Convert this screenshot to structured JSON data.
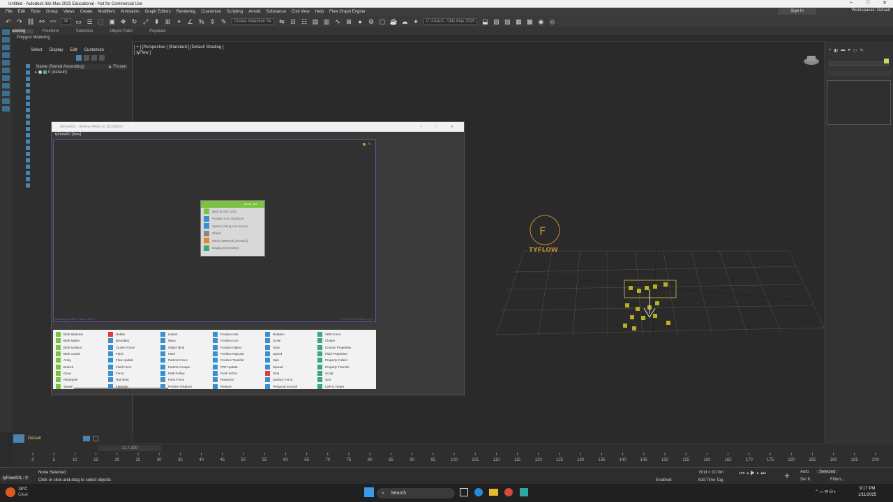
{
  "window": {
    "title": "Untitled - Autodesk 3ds Max 2025 Educational - Not for Commercial Use"
  },
  "menu": [
    "File",
    "Edit",
    "Tools",
    "Group",
    "Views",
    "Create",
    "Modifiers",
    "Animation",
    "Graph Editors",
    "Rendering",
    "Customize",
    "Scripting",
    "Arnold",
    "Substance",
    "Civil View",
    "Help",
    "Flow Graph Engine"
  ],
  "header": {
    "sign_in": "Sign In",
    "workspace": "Workspaces: Default"
  },
  "toolbar": {
    "filter": "All",
    "selection_set": "Create Selection Se",
    "path": "C:\\Users\\...\\3ds Max 2025"
  },
  "ribbon": {
    "tabs": [
      "Modeling",
      "Freeform",
      "Selection",
      "Object Paint",
      "Populate"
    ],
    "sub": "Polygon Modeling"
  },
  "scene_explorer": {
    "menu": [
      "Select",
      "Display",
      "Edit",
      "Customize"
    ],
    "column": "Name (Sorted Ascending)",
    "frozen": "▲ Frozen",
    "root": "0 (default)"
  },
  "viewport": {
    "label": "[ + ] [Perspective ] [Standard ] [Default Shading ]",
    "sublabel": "[ tyFlow ]",
    "logo_text": "TYFLOW"
  },
  "editor": {
    "title": "tyFlow001 - [tyFlow FREE v1.110 Editor]",
    "tab": "tyFlow001   [New]",
    "footer_left": "Caching enabled | Stats: 0/0/0/0",
    "footer_right": "Press TAB for Quick Type",
    "event": {
      "name": "Event_001",
      "operators": [
        "Birth (0-200: 200)",
        "Position Icon (Surface)",
        "Speed (Along icon arrow)",
        "Shape",
        "Mesh (NRMesh [Render])",
        "Display (Geometry)"
      ]
    },
    "palette": [
      [
        "Birth Skeleton",
        "Birth Spline",
        "Birth Surface",
        "Birth Voxels",
        "Array",
        "Branch",
        "Grow",
        "Resample",
        "Spawn"
      ],
      [
        "Delete",
        "Boundary",
        "Cluster Force",
        "Flock",
        "Flow Update",
        "Fluid Force",
        "Force",
        "Hair Bind",
        "Integrate"
      ],
      [
        "Limiter",
        "Mass",
        "Object Bind",
        "Pack",
        "Particle Force",
        "Particle Groups",
        "Path Follow",
        "Point Force",
        "Position Displace"
      ],
      [
        "Position Hair",
        "Position Icon",
        "Position Object",
        "Position Raycast",
        "Position Transfer",
        "PRT Update",
        "Push In/Out",
        "Rasterize",
        "Restore"
      ],
      [
        "Rotation",
        "Scale",
        "Slow",
        "Speed",
        "Spin",
        "Spread",
        "Stop",
        "Surface Force",
        "Temporal Smooth"
      ],
      [
        "VDB Force",
        "Cluster",
        "Custom Properties",
        "Fluid Properties",
        "Property Collect",
        "Property Transfer",
        "Script",
        "Sort",
        "Link to Target"
      ]
    ]
  },
  "bottom": {
    "layer": "Default",
    "frame_counter": "21 / 200",
    "ticks": [
      "0",
      "5",
      "10",
      "15",
      "20",
      "25",
      "30",
      "35",
      "40",
      "45",
      "50",
      "55",
      "60",
      "65",
      "70",
      "75",
      "80",
      "85",
      "90",
      "95",
      "100",
      "105",
      "110",
      "115",
      "120",
      "125",
      "130",
      "135",
      "140",
      "145",
      "150",
      "155",
      "160",
      "165",
      "170",
      "175",
      "180",
      "185",
      "190",
      "195",
      "200"
    ]
  },
  "status": {
    "none_selected": "None Selected",
    "prompt": "Click or click-and-drag to select objects",
    "grid": "Grid = 10.0m",
    "add_time_tag": "Add Time Tag",
    "enabled": "Enabled:",
    "auto": "Auto",
    "selected": "Selected",
    "setk": "Set K.",
    "filters": "Filters...",
    "script": "tyFlow001 : fr"
  },
  "taskbar": {
    "weather_temp": "18°C",
    "weather_desc": "Clear",
    "search": "Search",
    "time": "9:17 PM",
    "date": "1/11/2025"
  }
}
